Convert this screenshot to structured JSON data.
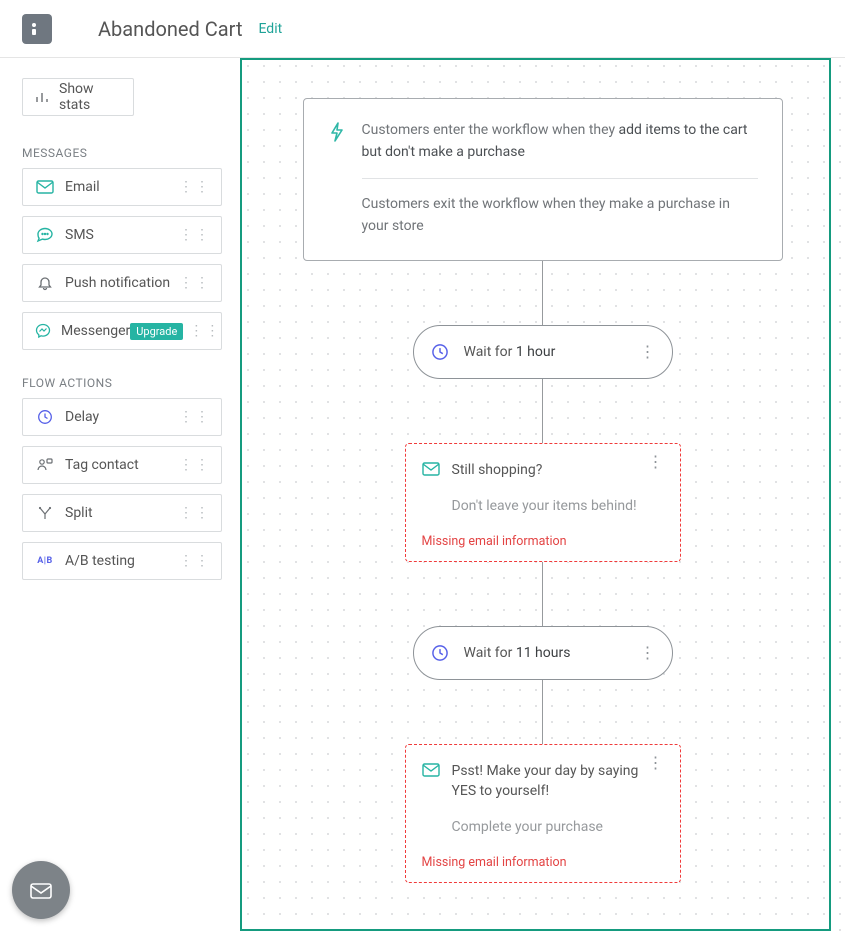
{
  "header": {
    "title": "Abandoned Cart",
    "edit": "Edit"
  },
  "sidebar": {
    "show_stats": "Show stats",
    "messages_label": "MESSAGES",
    "messages": [
      {
        "icon": "mail",
        "label": "Email"
      },
      {
        "icon": "chat",
        "label": "SMS"
      },
      {
        "icon": "bell",
        "label": "Push notification"
      },
      {
        "icon": "messenger",
        "label": "Messenger",
        "badge": "Upgrade"
      }
    ],
    "flow_label": "FLOW ACTIONS",
    "flow": [
      {
        "icon": "clock",
        "label": "Delay"
      },
      {
        "icon": "tag-contact",
        "label": "Tag contact"
      },
      {
        "icon": "split",
        "label": "Split"
      },
      {
        "icon": "ab",
        "label": "A/B testing"
      }
    ]
  },
  "canvas": {
    "entry": {
      "enter_prefix": "Customers enter the workflow when they ",
      "enter_strong": "add items to the cart but don't make a purchase",
      "exit_prefix": "Customers exit the workflow when they ",
      "exit_strong": "make a purchase in your store"
    },
    "wait1": {
      "prefix": "Wait for ",
      "value": "1 hour"
    },
    "email1": {
      "title": "Still shopping?",
      "sub": "Don't leave your items behind!",
      "error": "Missing email information"
    },
    "wait2": {
      "prefix": "Wait for ",
      "value": "11 hours"
    },
    "email2": {
      "title": "Psst! Make your day by saying YES to yourself!",
      "sub": "Complete your purchase",
      "error": "Missing email information"
    }
  }
}
